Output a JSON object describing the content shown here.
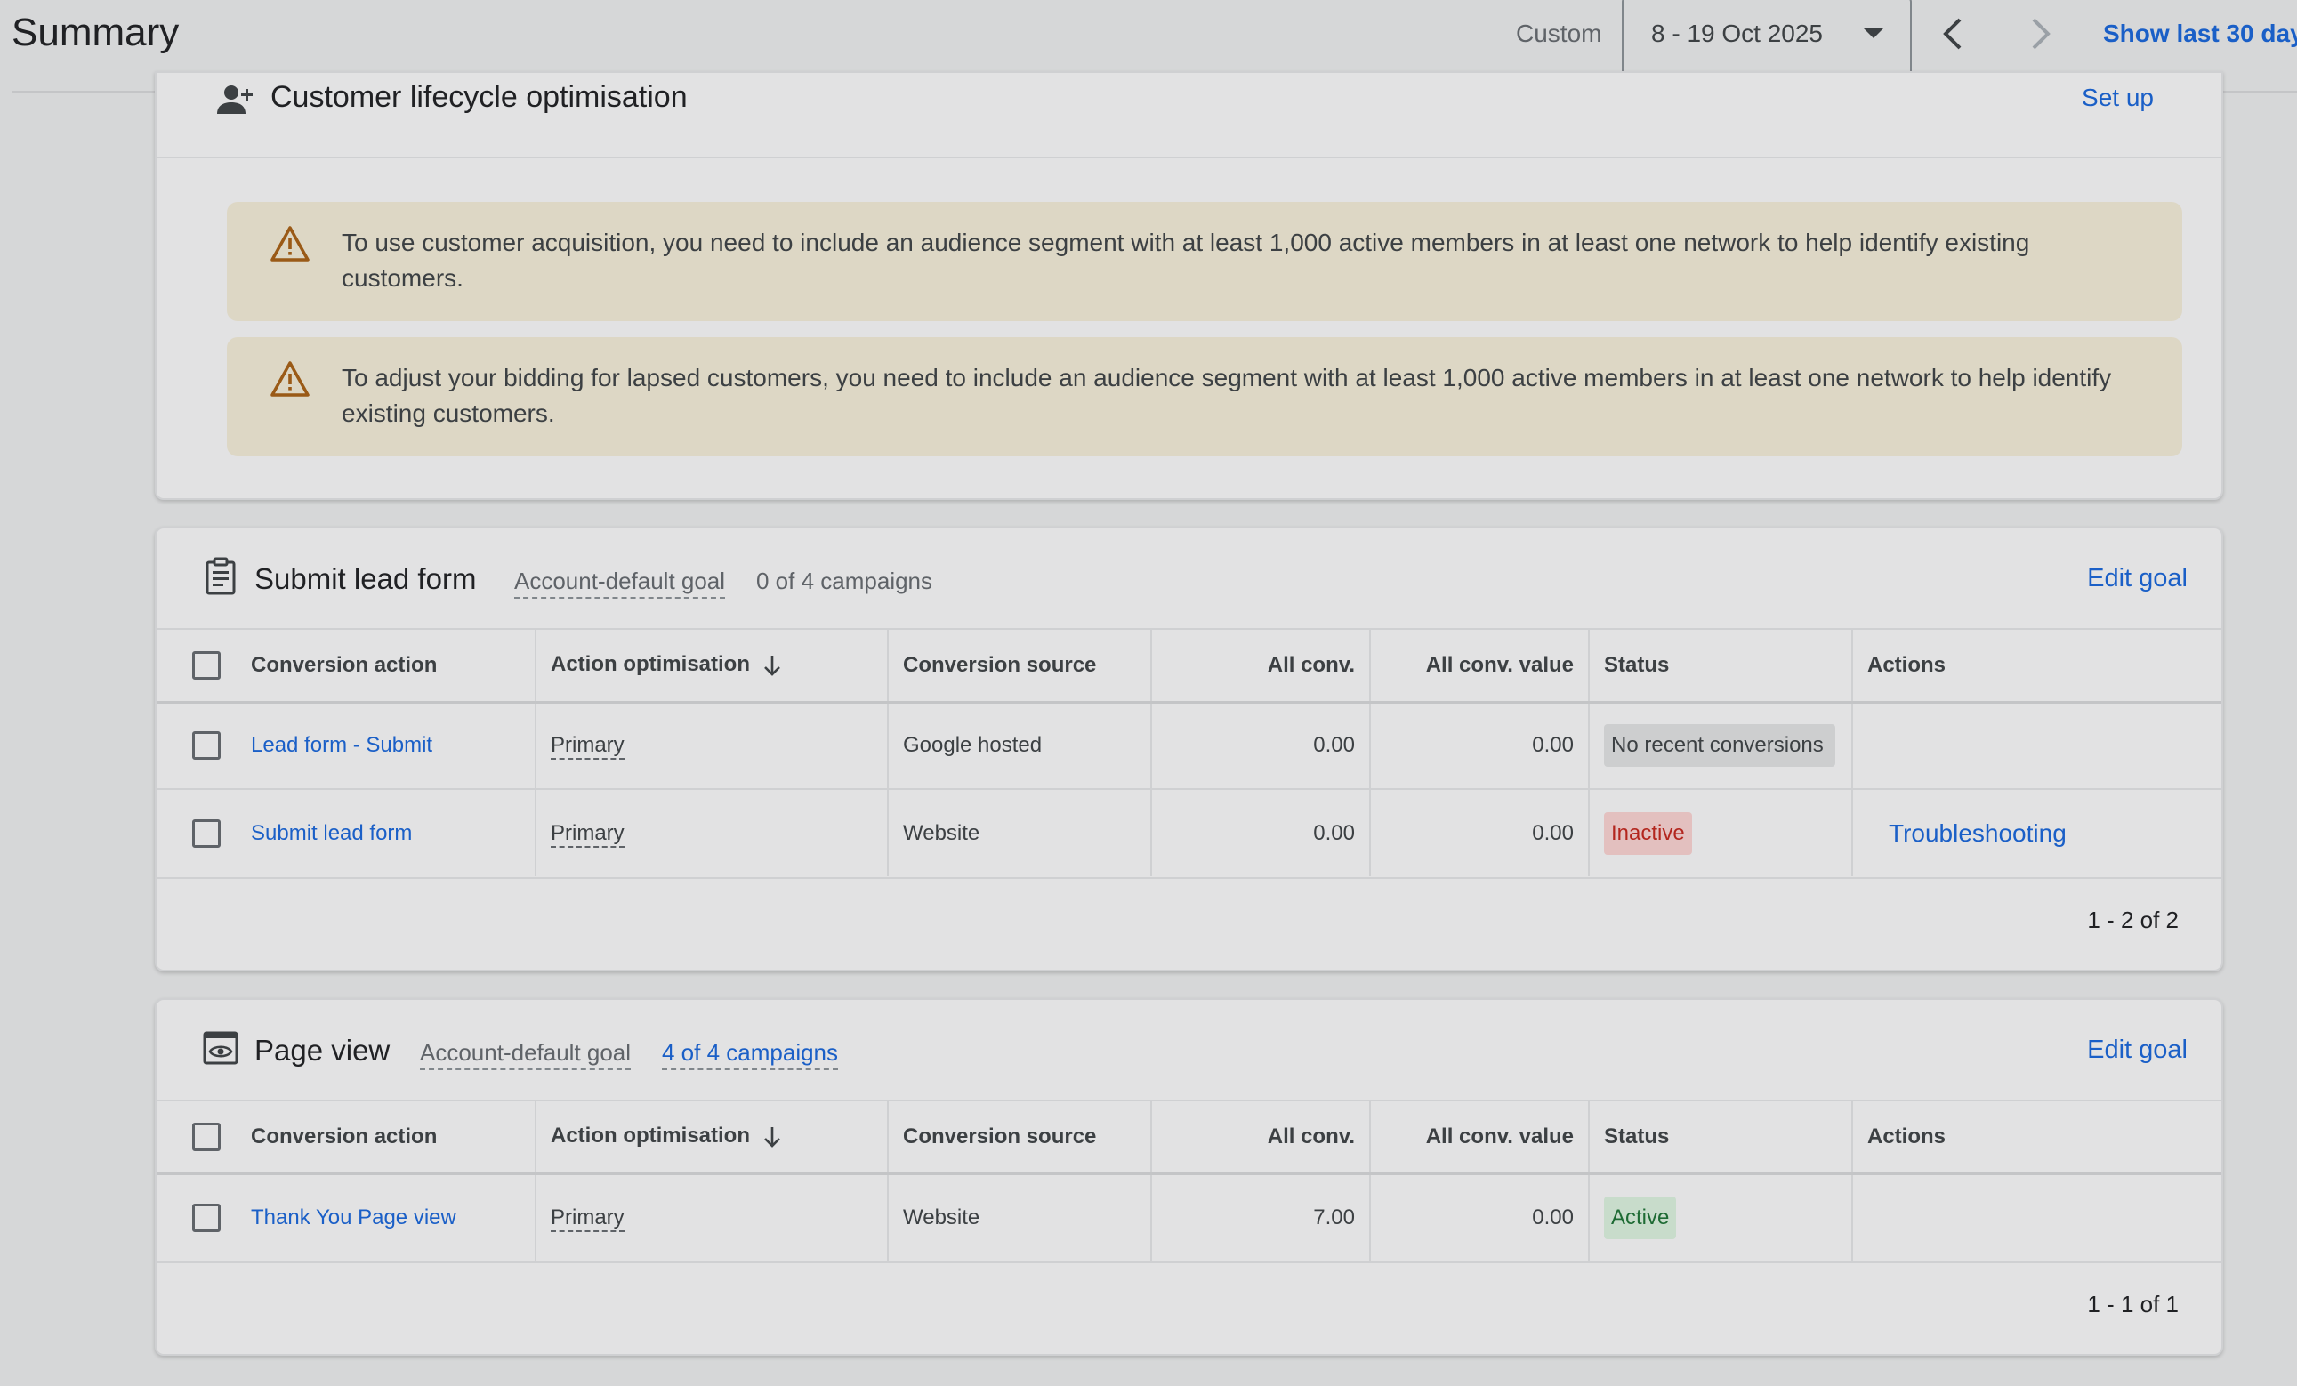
{
  "header": {
    "title": "Summary",
    "range_label": "Custom",
    "date_range": "8 - 19 Oct 2025",
    "show_last": "Show last 30 day"
  },
  "lifecycle": {
    "title": "Customer lifecycle optimisation",
    "setup_label": "Set up",
    "warnings": [
      "To use customer acquisition, you need to include an audience segment with at least 1,000 active members in at least one network to help identify existing customers.",
      "To adjust your bidding for lapsed customers, you need to include an audience segment with at least 1,000 active members in at least one network to help identify existing customers."
    ]
  },
  "columns": [
    "Conversion action",
    "Action optimisation",
    "Conversion source",
    "All conv.",
    "All conv. value",
    "Status",
    "Actions"
  ],
  "goals": [
    {
      "title": "Submit lead form",
      "goal_type": "Account-default goal",
      "campaigns": "0 of 4 campaigns",
      "edit_label": "Edit goal",
      "rows": [
        {
          "action": "Lead form - Submit",
          "optimisation": "Primary",
          "source": "Google hosted",
          "all_conv": "0.00",
          "all_conv_value": "0.00",
          "status": "No recent conversions",
          "actions": ""
        },
        {
          "action": "Submit lead form",
          "optimisation": "Primary",
          "source": "Website",
          "all_conv": "0.00",
          "all_conv_value": "0.00",
          "status": "Inactive",
          "actions": "Troubleshooting"
        }
      ],
      "pager": "1 - 2 of 2"
    },
    {
      "title": "Page view",
      "goal_type": "Account-default goal",
      "campaigns": "4 of 4 campaigns",
      "edit_label": "Edit goal",
      "rows": [
        {
          "action": "Thank You Page view",
          "optimisation": "Primary",
          "source": "Website",
          "all_conv": "7.00",
          "all_conv_value": "0.00",
          "status": "Active",
          "actions": ""
        }
      ],
      "pager": "1 - 1 of 1"
    }
  ],
  "colors": {
    "link": "#1a5fc7",
    "warning_bg": "#ddd7c5",
    "warning_icon": "#9a5a17",
    "inactive_bg": "#e3c0bf",
    "inactive_text": "#b3261e",
    "active_bg": "#c8dccb",
    "active_text": "#1e6b34"
  }
}
